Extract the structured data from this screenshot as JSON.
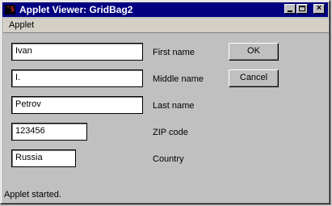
{
  "window": {
    "title": "Applet Viewer: GridBag2",
    "icon": "java-applet-icon"
  },
  "menu": {
    "items": [
      {
        "label": "Applet"
      }
    ]
  },
  "form": {
    "fields": [
      {
        "label": "First name",
        "value": "Ivan"
      },
      {
        "label": "Middle name",
        "value": "I."
      },
      {
        "label": "Last name",
        "value": "Petrov"
      },
      {
        "label": "ZIP code",
        "value": "123456"
      },
      {
        "label": "Country",
        "value": "Russia"
      }
    ]
  },
  "buttons": {
    "ok": "OK",
    "cancel": "Cancel"
  },
  "status": "Applet started."
}
